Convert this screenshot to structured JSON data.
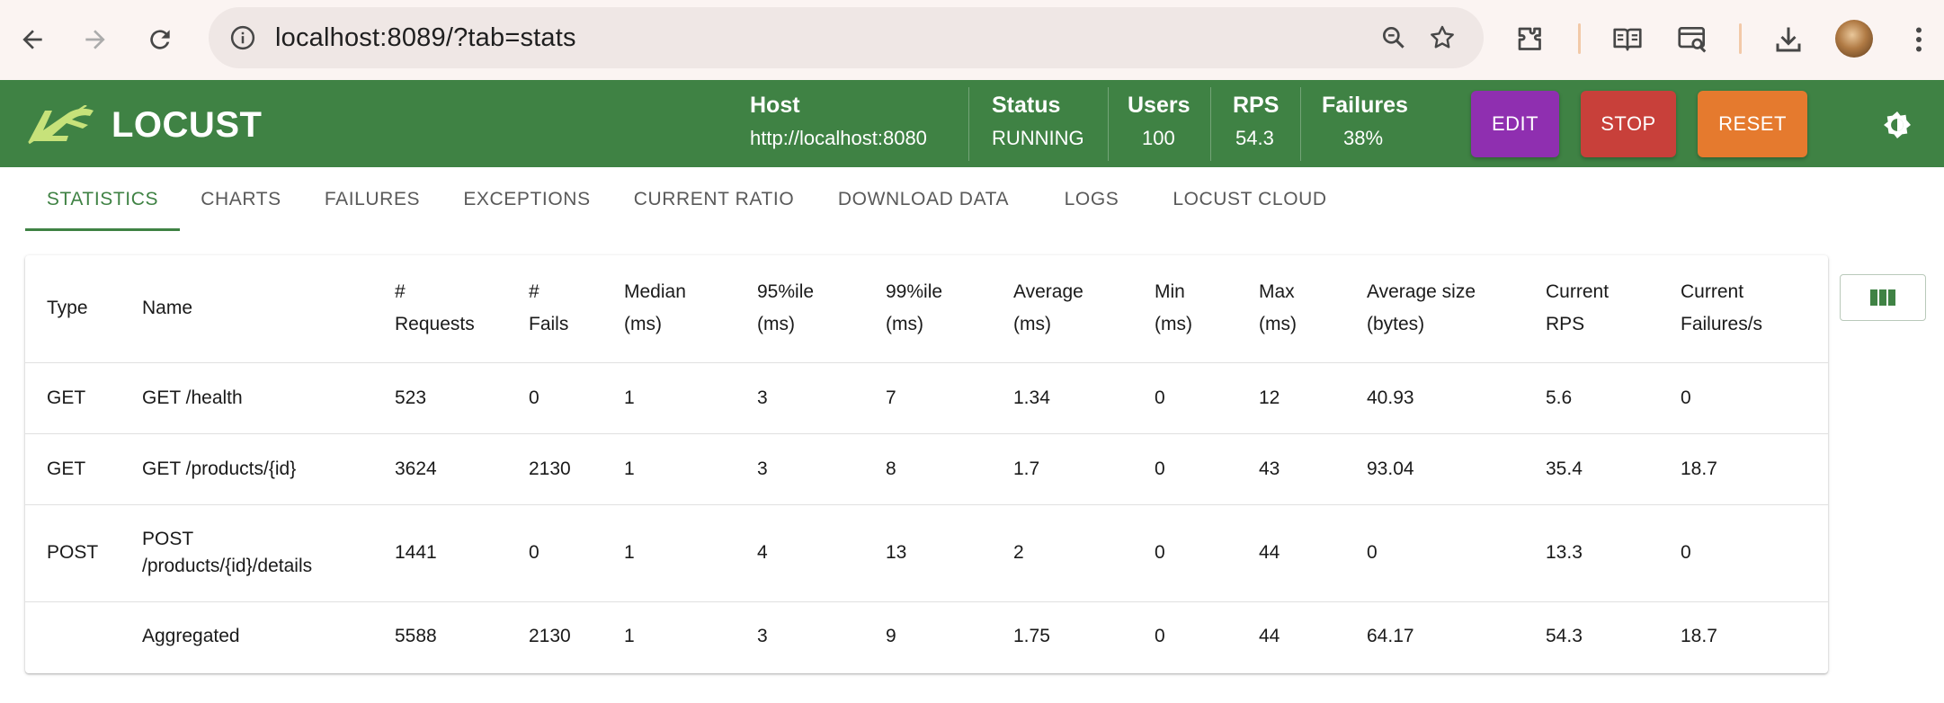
{
  "browser": {
    "url": "localhost:8089/?tab=stats"
  },
  "header": {
    "logo_text": "LOCUST",
    "host_label": "Host",
    "host_value": "http://localhost:8080",
    "status_label": "Status",
    "status_value": "RUNNING",
    "users_label": "Users",
    "users_value": "100",
    "rps_label": "RPS",
    "rps_value": "54.3",
    "failures_label": "Failures",
    "failures_value": "38%",
    "edit_label": "EDIT",
    "stop_label": "STOP",
    "reset_label": "RESET",
    "colors": {
      "header_bg": "#3f8244",
      "edit": "#8f2fb0",
      "stop": "#c8403a",
      "reset": "#e57a2e"
    }
  },
  "tabs": [
    {
      "label": "STATISTICS",
      "active": true
    },
    {
      "label": "CHARTS"
    },
    {
      "label": "FAILURES"
    },
    {
      "label": "EXCEPTIONS"
    },
    {
      "label": "CURRENT RATIO"
    },
    {
      "label": "DOWNLOAD DATA"
    },
    {
      "label": "LOGS"
    },
    {
      "label": "LOCUST CLOUD"
    }
  ],
  "table": {
    "headers": [
      [
        "Type"
      ],
      [
        "Name"
      ],
      [
        "#",
        "Requests"
      ],
      [
        "#",
        "Fails"
      ],
      [
        "Median",
        "(ms)"
      ],
      [
        "95%ile",
        "(ms)"
      ],
      [
        "99%ile",
        "(ms)"
      ],
      [
        "Average",
        "(ms)"
      ],
      [
        "Min",
        "(ms)"
      ],
      [
        "Max",
        "(ms)"
      ],
      [
        "Average size",
        "(bytes)"
      ],
      [
        "Current",
        "RPS"
      ],
      [
        "Current",
        "Failures/s"
      ]
    ],
    "rows": [
      {
        "type": "GET",
        "name": "GET /health",
        "requests": "523",
        "fails": "0",
        "median": "1",
        "p95": "3",
        "p99": "7",
        "avg": "1.34",
        "min": "0",
        "max": "12",
        "avg_size": "40.93",
        "rps": "5.6",
        "fails_s": "0"
      },
      {
        "type": "GET",
        "name": "GET /products/{id}",
        "requests": "3624",
        "fails": "2130",
        "median": "1",
        "p95": "3",
        "p99": "8",
        "avg": "1.7",
        "min": "0",
        "max": "43",
        "avg_size": "93.04",
        "rps": "35.4",
        "fails_s": "18.7"
      },
      {
        "type": "POST",
        "name_line1": "POST",
        "name_line2": "/products/{id}/details",
        "requests": "1441",
        "fails": "0",
        "median": "1",
        "p95": "4",
        "p99": "13",
        "avg": "2",
        "min": "0",
        "max": "44",
        "avg_size": "0",
        "rps": "13.3",
        "fails_s": "0"
      },
      {
        "type": "",
        "name": "Aggregated",
        "requests": "5588",
        "fails": "2130",
        "median": "1",
        "p95": "3",
        "p99": "9",
        "avg": "1.75",
        "min": "0",
        "max": "44",
        "avg_size": "64.17",
        "rps": "54.3",
        "fails_s": "18.7"
      }
    ]
  }
}
